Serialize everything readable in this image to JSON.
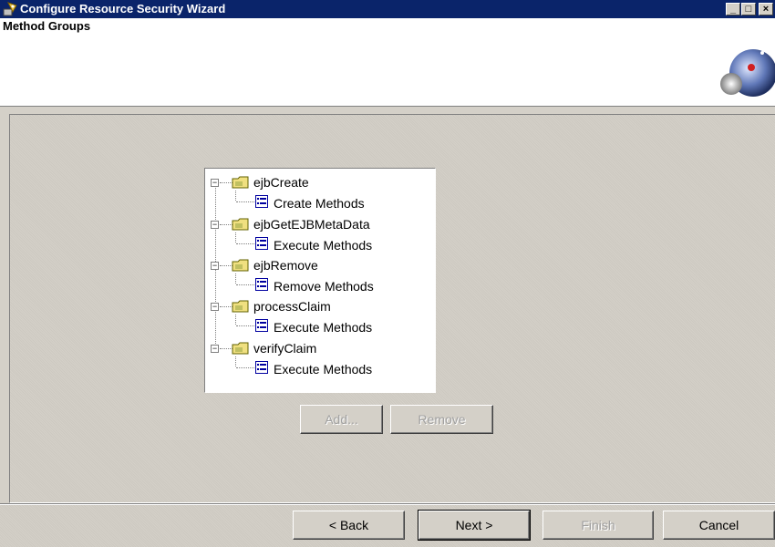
{
  "window": {
    "title": "Configure Resource Security Wizard",
    "minimize_glyph": "_",
    "maximize_glyph": "□",
    "close_glyph": "×"
  },
  "header": {
    "title": "Method Groups"
  },
  "tree": {
    "groups": [
      {
        "label": "ejbCreate",
        "child": "Create Methods",
        "expander": "−"
      },
      {
        "label": "ejbGetEJBMetaData",
        "child": "Execute Methods",
        "expander": "−"
      },
      {
        "label": "ejbRemove",
        "child": "Remove Methods",
        "expander": "−"
      },
      {
        "label": "processClaim",
        "child": "Execute Methods",
        "expander": "−"
      },
      {
        "label": "verifyClaim",
        "child": "Execute Methods",
        "expander": "−"
      }
    ]
  },
  "actions": {
    "add_label": "Add...",
    "remove_label": "Remove"
  },
  "wizard_buttons": {
    "back_label": "< Back",
    "next_label": "Next >",
    "finish_label": "Finish",
    "cancel_label": "Cancel"
  },
  "icons": {
    "app": "wizard-app-icon",
    "group": "folder-key-icon",
    "method_list": "list-icon",
    "logo": "globe-logo-icon"
  },
  "colors": {
    "titlebar": "#0a246a",
    "face": "#d4d0c8",
    "disabled_text": "#a0a0a0"
  }
}
